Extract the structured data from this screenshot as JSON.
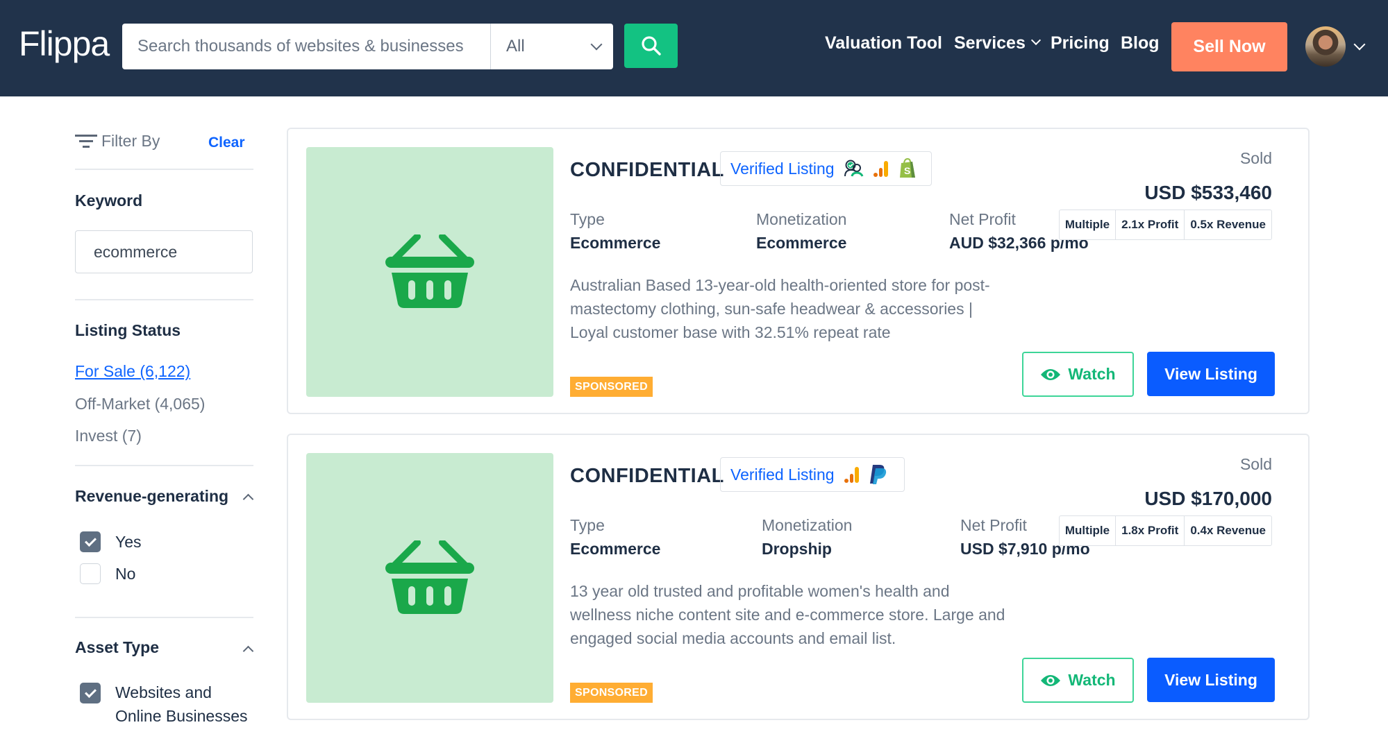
{
  "header": {
    "logo": "Flippa",
    "search": {
      "placeholder": "Search thousands of websites & businesses",
      "value": ""
    },
    "category_select": {
      "selected": "All"
    },
    "nav": [
      {
        "label": "Valuation Tool"
      },
      {
        "label": "Services",
        "has_dropdown": true
      },
      {
        "label": "Pricing"
      },
      {
        "label": "Blog"
      }
    ],
    "sell_button": "Sell Now",
    "colors": {
      "background": "#21334b",
      "search_button": "#13c282",
      "sell_button": "#ff8360"
    }
  },
  "sidebar": {
    "filter_label": "Filter By",
    "clear_label": "Clear",
    "keyword": {
      "heading": "Keyword",
      "value": "ecommerce"
    },
    "listing_status": {
      "heading": "Listing Status",
      "items": [
        {
          "label": "For Sale (6,122)",
          "active": true
        },
        {
          "label": "Off-Market (4,065)",
          "active": false
        },
        {
          "label": "Invest (7)",
          "active": false
        }
      ]
    },
    "revenue_generating": {
      "heading": "Revenue-generating",
      "options": [
        {
          "label": "Yes",
          "checked": true
        },
        {
          "label": "No",
          "checked": false
        }
      ]
    },
    "asset_type": {
      "heading": "Asset Type",
      "options": [
        {
          "label": "Websites and Online Businesses",
          "checked": true
        }
      ]
    }
  },
  "listings": [
    {
      "title": "CONFIDENTIAL",
      "verified_label": "Verified Listing",
      "verified_icons": [
        "verified-seller-icon",
        "analytics-icon",
        "shopify-icon"
      ],
      "image_icon": "shopping-basket-icon",
      "type_label": "Type",
      "type_value": "Ecommerce",
      "monetization_label": "Monetization",
      "monetization_value": "Ecommerce",
      "net_profit_label": "Net Profit",
      "net_profit_value": "AUD $32,366 p/mo",
      "status": "Sold",
      "price": "USD $533,460",
      "multiple_label": "Multiple",
      "profit_multiple": "2.1x Profit",
      "revenue_multiple": "0.5x Revenue",
      "description": "Australian Based 13-year-old health-oriented store for post-mastectomy clothing, sun-safe headwear & accessories | Loyal customer base with 32.51% repeat rate",
      "badge": "SPONSORED",
      "watch_label": "Watch",
      "view_label": "View Listing"
    },
    {
      "title": "CONFIDENTIAL",
      "verified_label": "Verified Listing",
      "verified_icons": [
        "analytics-icon",
        "paypal-icon"
      ],
      "image_icon": "shopping-basket-icon",
      "type_label": "Type",
      "type_value": "Ecommerce",
      "monetization_label": "Monetization",
      "monetization_value": "Dropship",
      "net_profit_label": "Net Profit",
      "net_profit_value": "USD $7,910 p/mo",
      "status": "Sold",
      "price": "USD $170,000",
      "multiple_label": "Multiple",
      "profit_multiple": "1.8x Profit",
      "revenue_multiple": "0.4x Revenue",
      "description": "13 year old trusted and profitable women's health and wellness niche content site and e-commerce store. Large and engaged social media accounts and email list.",
      "badge": "SPONSORED",
      "watch_label": "Watch",
      "view_label": "View Listing"
    }
  ]
}
